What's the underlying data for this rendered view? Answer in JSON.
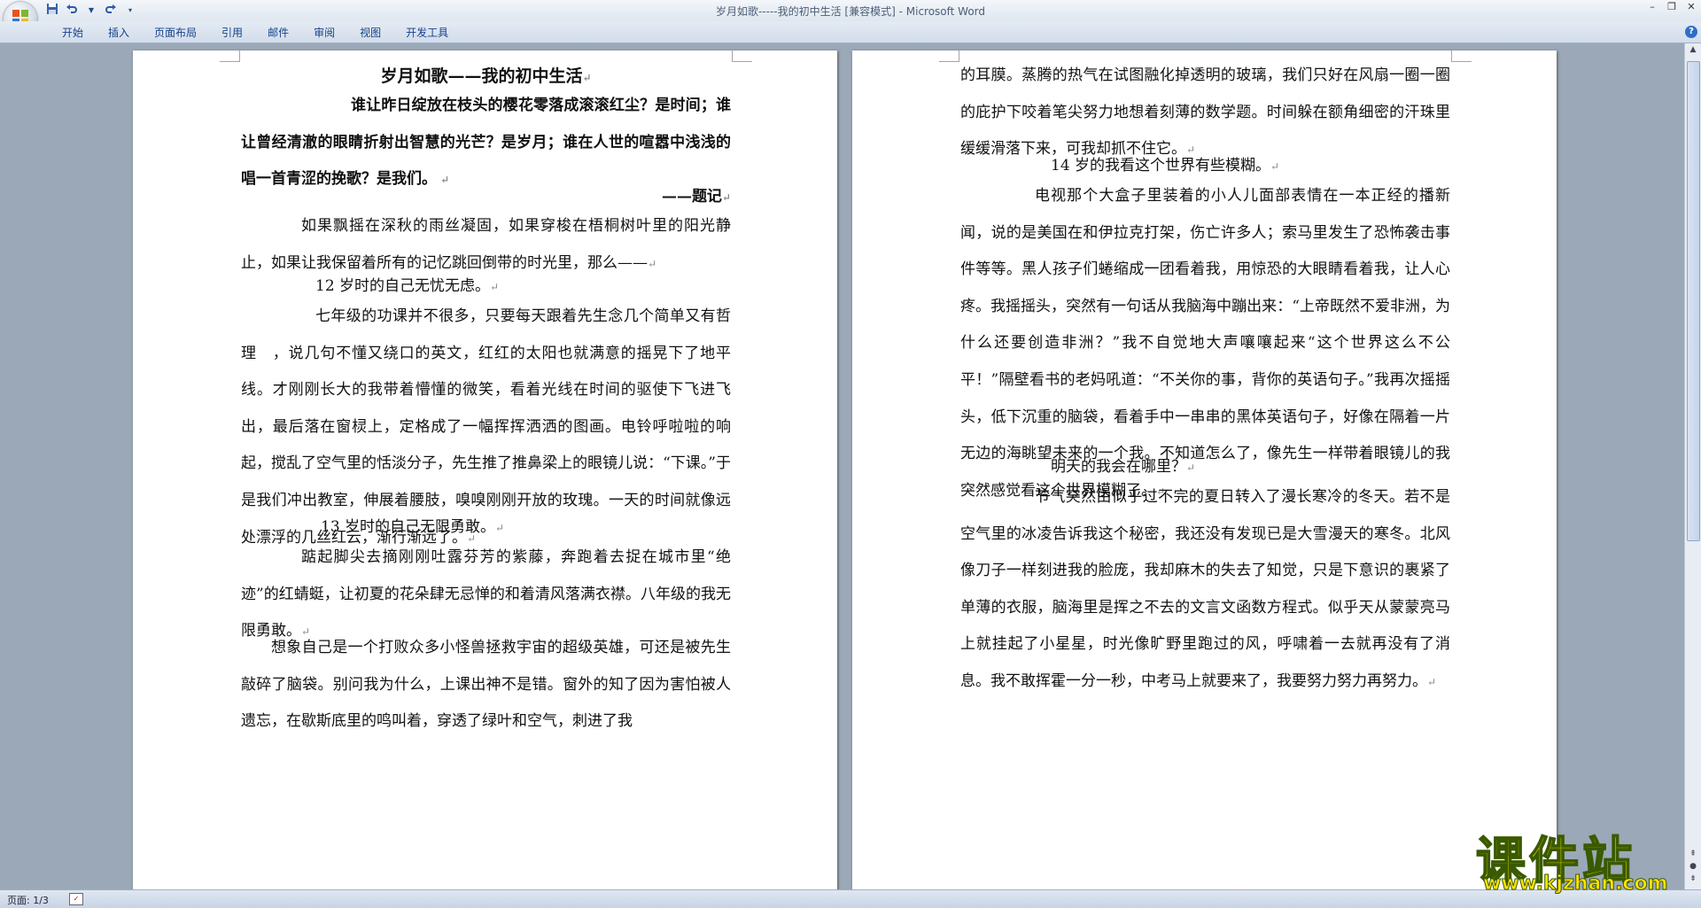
{
  "window": {
    "title": "岁月如歌-----我的初中生活 [兼容模式] - Microsoft Word"
  },
  "qat": {
    "save_icon": "save-icon",
    "undo_icon": "undo-icon",
    "redo_icon": "redo-icon",
    "customize_icon": "dropdown-icon"
  },
  "ribbon": {
    "tabs": [
      "开始",
      "插入",
      "页面布局",
      "引用",
      "邮件",
      "审阅",
      "视图",
      "开发工具"
    ]
  },
  "document": {
    "page1": [
      {
        "text": "岁月如歌——我的初中生活",
        "style": "title"
      },
      {
        "text": "谁让昨日绽放在枝头的樱花零落成滚滚红尘？是时间；谁让曾经清澈的眼睛折射出智慧的光芒？是岁月；谁在人世的喧嚣中浅浅的唱一首青涩的挽歌？是我们。",
        "style": "bold-indent"
      },
      {
        "text": "——题记",
        "style": "right-bold"
      },
      {
        "text": "如果飘摇在深秋的雨丝凝固，如果穿梭在梧桐树叶里的阳光静止，如果让我保留着所有的记忆跳回倒带的时光里，那么——",
        "style": "indent"
      },
      {
        "text": "12 岁时的自己无忧无虑。",
        "style": "deep-indent"
      },
      {
        "text": "七年级的功课并不很多，只要每天跟着先生念几个简单又有哲理　，说几句不懂又绕口的英文，红红的太阳也就满意的摇晃下了地平线。才刚刚长大的我带着懵懂的微笑，看着光线在时间的驱使下飞进飞出，最后落在窗棂上，定格成了一幅挥挥洒洒的图画。电铃呼啦啦的响起，搅乱了空气里的恬淡分子，先生推了推鼻梁上的眼镜儿说：“下课。”于是我们冲出教室，伸展着腰肢，嗅嗅刚刚开放的玫瑰。一天的时间就像远处漂浮的几丝红云，渐行渐远了。",
        "style": "deep-indent"
      },
      {
        "text": "13 岁时的自己无限勇敢。",
        "style": "deep-indent"
      },
      {
        "text": "踮起脚尖去摘刚刚吐露芬芳的紫藤，奔跑着去捉在城市里“绝迹”的红蜻蜓，让初夏的花朵肆无忌惮的和着清风落满衣襟。八年级的我无限勇敢。",
        "style": "indent"
      },
      {
        "text": "想象自己是一个打败众多小怪兽拯救宇宙的超级英雄，可还是被先生敲碎了脑袋。别问我为什么，上课出神不是错。窗外的知了因为害怕被人遗忘，在歇斯底里的鸣叫着，穿透了绿叶和空气，刺进了我",
        "style": "small-indent"
      }
    ],
    "page2": [
      {
        "text": "的耳膜。蒸腾的热气在试图融化掉透明的玻璃，我们只好在风扇一圈一圈的庇护下咬着笔尖努力地想着刻薄的数学题。时间躲在额角细密的汗珠里缓缓滑落下来，可我却抓不住它。",
        "style": "plain"
      },
      {
        "text": "14 岁的我看这个世界有些模糊。",
        "style": "deep-indent"
      },
      {
        "text": "电视那个大盒子里装着的小人儿面部表情在一本正经的播新闻，说的是美国在和伊拉克打架，伤亡许多人；索马里发生了恐怖袭击事件等等。黑人孩子们蜷缩成一团看着我，用惊恐的大眼睛看着我，让人心疼。我摇摇头，突然有一句话从我脑海中蹦出来：“上帝既然不爱非洲，为什么还要创造非洲？”我不自觉地大声嚷嚷起来“这个世界这么不公平！”隔壁看书的老妈吼道：“不关你的事，背你的英语句子。”我再次摇摇头，低下沉重的脑袋，看着手中一串串的黑体英语句子，好像在隔着一片无边的海眺望未来的一个我。不知道怎么了，像先生一样带着眼镜儿的我突然感觉看这个世界模糊了。",
        "style": "indent"
      },
      {
        "text": "明天的我会在哪里？",
        "style": "deep-indent"
      },
      {
        "text": "节气突然由似乎过不完的夏日转入了漫长寒冷的冬天。若不是空气里的冰凌告诉我这个秘密，我还没有发现已是大雪漫天的寒冬。北风像刀子一样刻进我的脸庞，我却麻木的失去了知觉，只是下意识的裹紧了单薄的衣服，脑海里是挥之不去的文言文函数方程式。似乎天从蒙蒙亮马上就挂起了小星星，时光像旷野里跑过的风，呼啸着一去就再没有了消息。我不敢挥霍一分一秒，中考马上就要来了，我要努力努力再努力。",
        "style": "indent"
      }
    ],
    "paragraph_mark": "↵"
  },
  "status": {
    "page_count": "页面: 1/3"
  },
  "watermark": {
    "name": "课件站",
    "url": "www.kjzhan.com"
  }
}
